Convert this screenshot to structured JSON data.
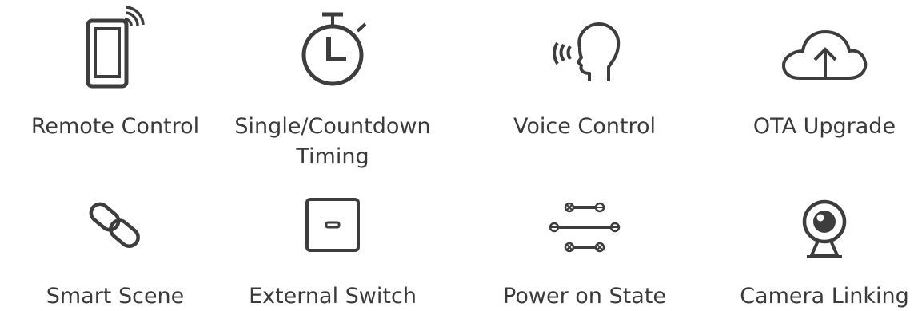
{
  "features": [
    {
      "label": "Remote Control",
      "icon": "smartphone-signal-icon"
    },
    {
      "label": "Single/Countdown Timing",
      "line1": "Single/Countdown",
      "line2": "Timing",
      "icon": "stopwatch-icon"
    },
    {
      "label": "Voice Control",
      "icon": "voice-head-icon"
    },
    {
      "label": "OTA Upgrade",
      "icon": "cloud-upload-icon"
    },
    {
      "label": "Smart Scene",
      "icon": "link-chain-icon"
    },
    {
      "label": "External Switch",
      "icon": "wall-switch-icon"
    },
    {
      "label": "Power on State",
      "icon": "power-state-sliders-icon"
    },
    {
      "label": "Camera Linking",
      "icon": "webcam-icon"
    }
  ],
  "colors": {
    "icon": "#3d3d3d",
    "text": "#3a3a3a",
    "background": "#ffffff"
  }
}
